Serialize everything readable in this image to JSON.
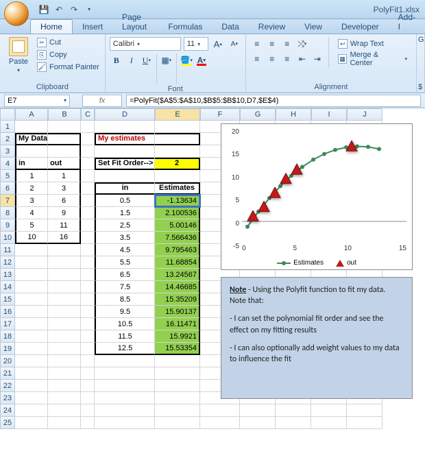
{
  "title": "PolyFit1.xlsx",
  "tabs": [
    "Home",
    "Insert",
    "Page Layout",
    "Formulas",
    "Data",
    "Review",
    "View",
    "Developer",
    "Add-I"
  ],
  "active_tab": 0,
  "ribbon": {
    "clipboard": {
      "title": "Clipboard",
      "paste": "Paste",
      "cut": "Cut",
      "copy": "Copy",
      "format_painter": "Format Painter"
    },
    "font": {
      "title": "Font",
      "name": "Calibri",
      "size": "11",
      "grow": "A",
      "shrink": "A",
      "bold": "B",
      "italic": "I",
      "underline": "U"
    },
    "alignment": {
      "title": "Alignment",
      "wrap": "Wrap Text",
      "merge": "Merge & Center"
    }
  },
  "namebox": "E7",
  "formula": "=PolyFit($A$5:$A$10,$B$5:$B$10,D7,$E$4)",
  "columns": [
    "A",
    "B",
    "C",
    "D",
    "E",
    "F",
    "G",
    "H",
    "I",
    "J"
  ],
  "row_count": 25,
  "selected_cell": {
    "row": 7,
    "col": "E"
  },
  "data": {
    "A2": "My Data",
    "D2": "My estimates",
    "A4": "in",
    "B4": "out",
    "D4": "Set Fit Order-->",
    "E4": "2",
    "A5": "1",
    "B5": "1",
    "A6": "2",
    "B6": "3",
    "A7": "3",
    "B7": "6",
    "A8": "4",
    "B8": "9",
    "A9": "5",
    "B9": "11",
    "A10": "10",
    "B10": "16",
    "D6": "in",
    "E6": "Estimates",
    "D7": "0.5",
    "E7": "-1.13634",
    "D8": "1.5",
    "E8": "2.100536",
    "D9": "2.5",
    "E9": "5.00146",
    "D10": "3.5",
    "E10": "7.566436",
    "D11": "4.5",
    "E11": "9.795463",
    "D12": "5.5",
    "E12": "11.68854",
    "D13": "6.5",
    "E13": "13.24567",
    "D14": "7.5",
    "E14": "14.46685",
    "D15": "8.5",
    "E15": "15.35209",
    "D16": "9.5",
    "E16": "15.90137",
    "D17": "10.5",
    "E17": "16.11471",
    "D18": "11.5",
    "E18": "15.9921",
    "D19": "12.5",
    "E19": "15.53354"
  },
  "chart_data": {
    "type": "line-scatter",
    "title": "",
    "xlim": [
      0,
      15
    ],
    "ylim": [
      -5,
      20
    ],
    "yticks": [
      -5,
      0,
      5,
      10,
      15,
      20
    ],
    "xticks": [
      0,
      5,
      10,
      15
    ],
    "series": [
      {
        "name": "Estimates",
        "type": "line",
        "x": [
          0.5,
          1.5,
          2.5,
          3.5,
          4.5,
          5.5,
          6.5,
          7.5,
          8.5,
          9.5,
          10.5,
          11.5,
          12.5
        ],
        "y": [
          -1.14,
          2.1,
          5.0,
          7.57,
          9.8,
          11.69,
          13.25,
          14.47,
          15.35,
          15.9,
          16.11,
          15.99,
          15.53
        ]
      },
      {
        "name": "out",
        "type": "scatter-triangle",
        "x": [
          1,
          2,
          3,
          4,
          5,
          10
        ],
        "y": [
          1,
          3,
          6,
          9,
          11,
          16
        ]
      }
    ],
    "legend": [
      "Estimates",
      "out"
    ]
  },
  "note": {
    "line1_a": "Note",
    "line1_b": " - Using the Polyfit function to fit my data.  Note that:",
    "line2": "- I can set the polynomial fit order and see the effect on my fitting results",
    "line3": "- I can also optionally add weight values to my data to influence the fit"
  }
}
